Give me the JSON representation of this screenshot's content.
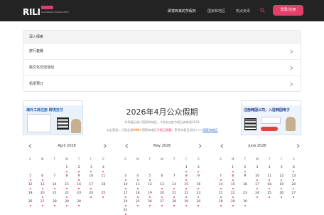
{
  "header": {
    "logo": "RILI",
    "logo_subtitle": "CALENDAR HOLIDAY INFO",
    "nav": [
      {
        "label": "即将到来的节假日",
        "active": true
      },
      {
        "label": "国家和地区",
        "active": false
      },
      {
        "label": "热点资讯",
        "active": false
      }
    ],
    "login_label": "登录/注册",
    "accent": "#e33f69"
  },
  "explore": {
    "title": "深入探索",
    "items": [
      "旅行套餐",
      "跨文化交流活动",
      "机票预订"
    ]
  },
  "holiday": {
    "title": "2026年4月公众假期",
    "line1": "为您展示热门国家和地区，4月份法定节假日安排表2026",
    "line2_a": "点击登录，订阅全球",
    "line2_count": "200+",
    "line2_b": "国家和地区",
    "line2_red": "节假日提醒",
    "line2_c": "，更多节假日前往>>>",
    "line2_link": "国家和地区"
  },
  "ads": [
    {
      "title": "海外工商注册 跨境支付"
    },
    {
      "title": "注册韩国公司，入驻韩国电子"
    }
  ],
  "calendars": [
    {
      "month": "April 2026",
      "weekdays": [
        "S",
        "M",
        "T",
        "W",
        "T",
        "F",
        "S"
      ],
      "weeks": [
        [
          "",
          "",
          "",
          "1",
          "2",
          "3",
          "4"
        ],
        [
          "5",
          "6",
          "7",
          "8",
          "9",
          "10",
          "11"
        ],
        [
          "12",
          "13",
          "14",
          "15",
          "16",
          "17",
          "18"
        ],
        [
          "19",
          "20",
          "21",
          "22",
          "23",
          "24",
          "25"
        ],
        [
          "26",
          "27",
          "28",
          "29",
          "30",
          "",
          ""
        ]
      ]
    },
    {
      "month": "May 2026",
      "weekdays": [
        "S",
        "M",
        "T",
        "W",
        "T",
        "F",
        "S"
      ],
      "weeks": [
        [
          "",
          "",
          "",
          "",
          "",
          "1",
          "2"
        ],
        [
          "3",
          "4",
          "5",
          "6",
          "7",
          "8",
          "9"
        ],
        [
          "10",
          "11",
          "12",
          "13",
          "14",
          "15",
          "16"
        ],
        [
          "17",
          "18",
          "19",
          "20",
          "21",
          "22",
          "23"
        ],
        [
          "24",
          "25",
          "26",
          "27",
          "28",
          "29",
          "30"
        ],
        [
          "31",
          "",
          "",
          "",
          "",
          "",
          ""
        ]
      ]
    },
    {
      "month": "June 2026",
      "weekdays": [
        "S",
        "M",
        "T",
        "W",
        "T",
        "F",
        "S"
      ],
      "weeks": [
        [
          "",
          "1",
          "2",
          "3",
          "4",
          "5",
          "6"
        ],
        [
          "7",
          "8",
          "9",
          "10",
          "11",
          "12",
          "13"
        ],
        [
          "14",
          "15",
          "16",
          "17",
          "18",
          "19",
          "20"
        ],
        [
          "21",
          "22",
          "23",
          "24",
          "25",
          "26",
          "27"
        ],
        [
          "28",
          "29",
          "30",
          "",
          "",
          "",
          ""
        ]
      ]
    }
  ]
}
